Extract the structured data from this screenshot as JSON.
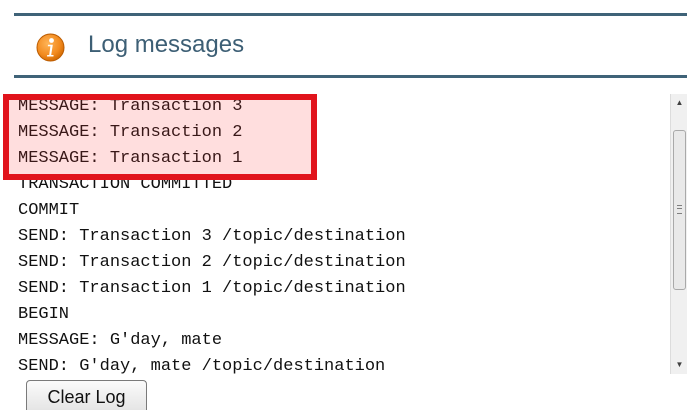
{
  "header": {
    "title": "Log messages",
    "icon": "info-icon",
    "accent_color": "#3f6378",
    "icon_color": "#f28a1e"
  },
  "log": {
    "lines": [
      "MESSAGE: Transaction 3",
      "MESSAGE: Transaction 2",
      "MESSAGE: Transaction 1",
      "TRANSACTION COMMITTED",
      "COMMIT",
      "SEND: Transaction 3 /topic/destination",
      "SEND: Transaction 2 /topic/destination",
      "SEND: Transaction 1 /topic/destination",
      "BEGIN",
      "MESSAGE: G'day, mate",
      "SEND: G'day, mate /topic/destination"
    ],
    "highlighted_count": 3,
    "highlight_color": "#e1141c"
  },
  "actions": {
    "clear_label": "Clear Log"
  }
}
